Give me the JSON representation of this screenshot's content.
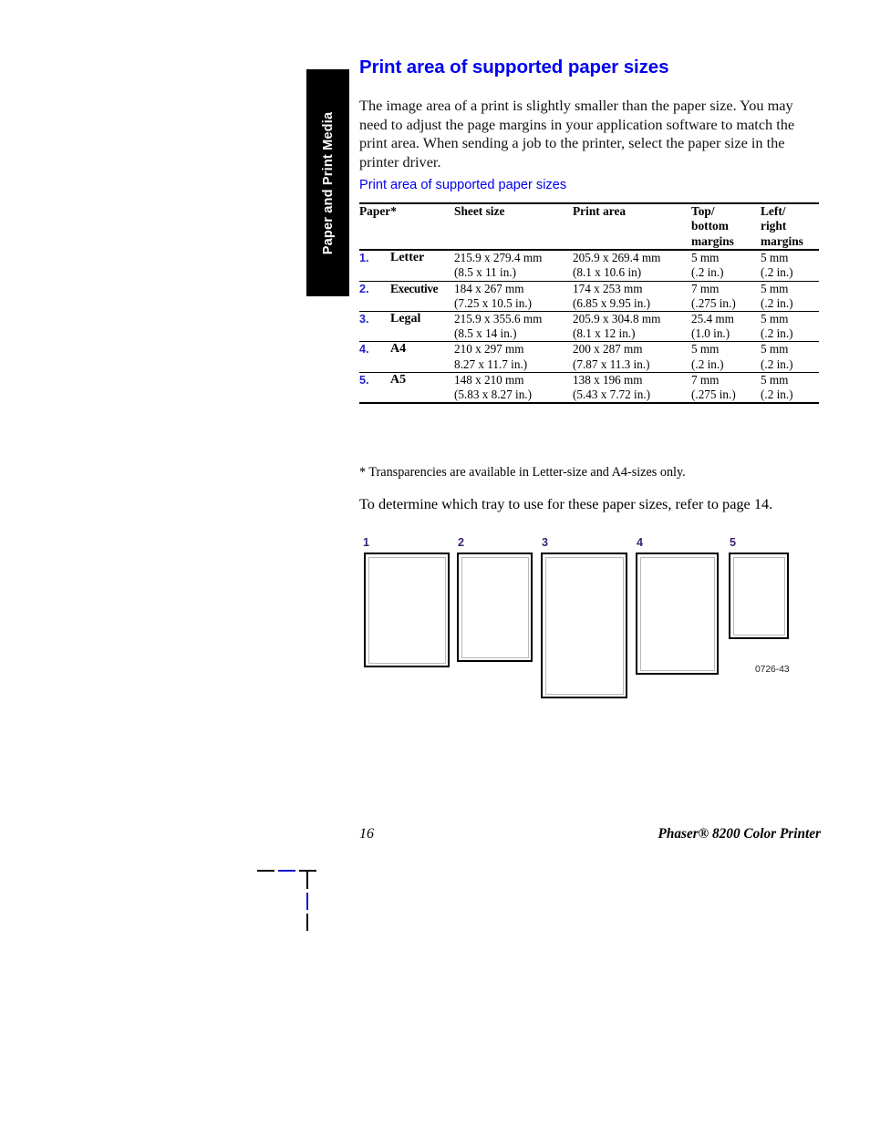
{
  "chapter_tab": {
    "label": "Paper and Print Media"
  },
  "page": {
    "title": "Print area of supported paper sizes",
    "intro": "The image area of a print is slightly smaller than the paper size. You may need to adjust the page margins in your application software to match the print area. When sending a job to the printer, select the paper size in the printer driver.",
    "table_caption": "Print area of supported paper sizes",
    "footnote": "* Transparencies are available in Letter-size and A4-sizes only.",
    "tray_note": "To determine which tray to use for these paper sizes, refer to page 14."
  },
  "table": {
    "headers": {
      "paper": "Paper*",
      "sheet_size": "Sheet size",
      "print_area": "Print area",
      "top_bottom_margins": "Top/\nbottom\nmargins",
      "top_bottom_margins_lines": [
        "Top/",
        "bottom",
        "margins"
      ],
      "left_right_margins_lines": [
        "Left/",
        "right",
        "margins"
      ]
    },
    "rows": [
      {
        "number": "1.",
        "name": "Letter",
        "sheet_mm": "215.9 x 279.4 mm",
        "sheet_in": "(8.5 x 11 in.)",
        "print_mm": "205.9 x 269.4 mm",
        "print_in": "(8.1 x 10.6 in)",
        "tb_mm": "5 mm",
        "tb_in": "(.2 in.)",
        "lr_mm": "5 mm",
        "lr_in": "(.2 in.)"
      },
      {
        "number": "2.",
        "name": "Executive",
        "sheet_mm": "184 x 267 mm",
        "sheet_in": "(7.25 x 10.5 in.)",
        "print_mm": "174 x 253 mm",
        "print_in": "(6.85 x 9.95 in.)",
        "tb_mm": "7 mm",
        "tb_in": "(.275 in.)",
        "lr_mm": "5 mm",
        "lr_in": "(.2 in.)"
      },
      {
        "number": "3.",
        "name": "Legal",
        "sheet_mm": "215.9 x 355.6 mm",
        "sheet_in": "(8.5 x 14 in.)",
        "print_mm": "205.9 x 304.8 mm",
        "print_in": "(8.1 x 12 in.)",
        "tb_mm": "25.4 mm",
        "tb_in": "(1.0 in.)",
        "lr_mm": "5 mm",
        "lr_in": "(.2 in.)"
      },
      {
        "number": "4.",
        "name": "A4",
        "sheet_mm": "210 x 297 mm",
        "sheet_in": "8.27 x 11.7 in.)",
        "print_mm": "200 x 287 mm",
        "print_in": "(7.87 x 11.3 in.)",
        "tb_mm": "5 mm",
        "tb_in": "(.2 in.)",
        "lr_mm": "5 mm",
        "lr_in": "(.2 in.)"
      },
      {
        "number": "5.",
        "name": "A5",
        "sheet_mm": "148 x 210 mm",
        "sheet_in": "(5.83 x 8.27 in.)",
        "print_mm": "138 x 196 mm",
        "print_in": "(5.43 x 7.72 in.)",
        "tb_mm": "7 mm",
        "tb_in": "(.275 in.)",
        "lr_mm": "5 mm",
        "lr_in": "(.2 in.)"
      }
    ]
  },
  "figure": {
    "id_label": "0726-43",
    "shapes": [
      {
        "number": "1"
      },
      {
        "number": "2"
      },
      {
        "number": "3"
      },
      {
        "number": "4"
      },
      {
        "number": "5"
      }
    ]
  },
  "footer": {
    "page_number": "16",
    "product": "Phaser® 8200 Color Printer"
  },
  "colors": {
    "heading_blue": "#0000ee",
    "row_number_blue": "#2222cc",
    "figure_number_purple": "#3b2172",
    "crop_mark_blue": "#1414d0",
    "tab_background": "#000000",
    "print_area_gray": "#b8b8b8"
  }
}
